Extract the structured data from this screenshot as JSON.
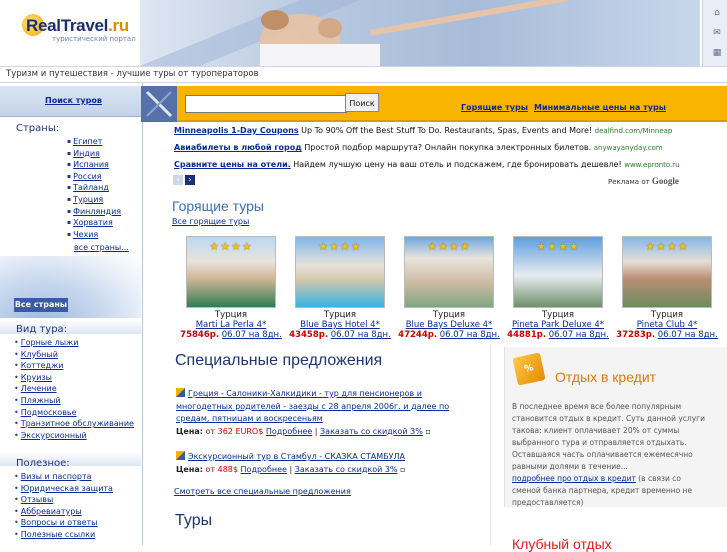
{
  "header": {
    "logo_main": "RealTravel",
    "logo_tld": ".ru",
    "logo_sub": "туристический портал",
    "tagline": "Туризм и путешествия - лучшие туры от туроператоров"
  },
  "left": {
    "tours_tab": "Поиск туров",
    "countries_title": "Страны:",
    "countries": [
      "Египет",
      "Индия",
      "Испания",
      "Россия",
      "Тайланд",
      "Турция",
      "Финляндия",
      "Хорватия",
      "Чехия"
    ],
    "all_countries_link": "все страны...",
    "all_countries_button": "Все страны",
    "tour_types_title": "Вид тура:",
    "tour_types": [
      "Горные лыжи",
      "Клубный",
      "Коттеджи",
      "Круизы",
      "Лечение",
      "Пляжный",
      "Подмосковье",
      "Транзитное обслуживание",
      "Экскурсионный"
    ],
    "useful_title": "Полезное:",
    "useful": [
      "Визы и паспорта",
      "Юридическая защита",
      "Отзывы",
      "Аббревиатуры",
      "Вопросы и ответы",
      "Полезные ссылки"
    ]
  },
  "search": {
    "button": "Поиск",
    "value": "",
    "hot_link": "Горящие туры",
    "min_link": "Минимальные цены на туры"
  },
  "ads": [
    {
      "title": "Minneapolis 1-Day Coupons",
      "text": " Up To 90% Off the Best Stuff To Do. Restaurants, Spas, Events and More! ",
      "url": "dealfind.com/Minneap"
    },
    {
      "title": "Авиабилеты в любой город",
      "text": " Простой подбор маршрута? Онлайн покупка электронных билетов. ",
      "url": "anywayanyday.com"
    },
    {
      "title": "Сравните цены на отели.",
      "text": " Найдем лучшую цену на ваш отель и подскажем, где бронировать дешевле! ",
      "url": "www.epronto.ru"
    }
  ],
  "ads_credit": "Реклама от",
  "ads_google": "Google",
  "hot": {
    "title": "Горящие туры",
    "all_link": "Все горящие туры",
    "cards": [
      {
        "country": "Турция",
        "name": "Marti La Perla 4*",
        "price": "75846р.",
        "date": "06.07 на 8дн.",
        "stars": "★★★★"
      },
      {
        "country": "Турция",
        "name": "Blue Bays Hotel 4*",
        "price": "43458р.",
        "date": "06.07 на 8дн.",
        "stars": "★★★★"
      },
      {
        "country": "Турция",
        "name": "Blue Bays Deluxe 4*",
        "price": "47244р.",
        "date": "06.07 на 8дн.",
        "stars": "★★★★"
      },
      {
        "country": "Турция",
        "name": "Pineta Park Deluxe 4*",
        "price": "44881р.",
        "date": "06.07 на 8дн.",
        "stars": "★★★★"
      },
      {
        "country": "Турция",
        "name": "Pineta Club 4*",
        "price": "37283р.",
        "date": "06.07 на 8дн.",
        "stars": "★★★★"
      }
    ]
  },
  "special": {
    "title": "Специальные предложения",
    "offers": [
      {
        "link": "Греция - Салоники-Халкидики - тур для пенсионеров и многодетных родителей - заезды с 28 апреля 2006г. и далее по средам, пятницам и воскресеньям",
        "price_label": "Цена:",
        "price_prefix": " от ",
        "price": "362 EURO$",
        "more": "Подробнее",
        "sep": " | ",
        "book": "Заказать со скидкой 3%"
      },
      {
        "link": "Экскурсионный тур в Стамбул - СКАЗКА СТАМБУЛА",
        "price_label": "Цена:",
        "price_prefix": " от ",
        "price": "488$",
        "more": "Подробнее",
        "sep": " | ",
        "book": "Заказать со скидкой 3%"
      }
    ],
    "all_link": "Смотреть все специальные предложения"
  },
  "tours_title": "Туры",
  "credit": {
    "icon_text": "%",
    "title": "Отдых в кредит",
    "text": "В последнее время все более популярным становится отдых в кредит. Суть данной услуги такова: клиент оплачивает 20% от суммы выбранного тура и отправляется отдыхать. Оставшаяся часть оплачивается ежемесячно равными долями в течение...",
    "more_link": "подробнее про отдых в кредит",
    "more_text": " (в связи со сменой банка партнера, кредит временно не предоставляется)"
  },
  "club_title": "Клубный отдых"
}
